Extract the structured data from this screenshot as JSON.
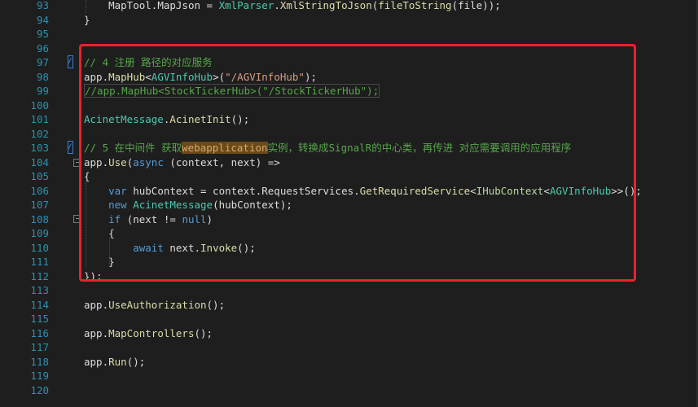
{
  "lines": [
    {
      "num": "93",
      "tokens": [
        {
          "t": "    MapTool.",
          "c": "t-d"
        },
        {
          "t": "MapJson",
          "c": "t-d"
        },
        {
          "t": " = ",
          "c": "t-d"
        },
        {
          "t": "XmlParser",
          "c": "t-y"
        },
        {
          "t": ".",
          "c": "t-d"
        },
        {
          "t": "XmlStringToJson",
          "c": "t-m"
        },
        {
          "t": "(",
          "c": "t-d"
        },
        {
          "t": "fileToString",
          "c": "t-m"
        },
        {
          "t": "(file));",
          "c": "t-d"
        }
      ]
    },
    {
      "num": "94",
      "tokens": [
        {
          "t": "}",
          "c": "t-d"
        }
      ]
    },
    {
      "num": "95",
      "tokens": []
    },
    {
      "num": "96",
      "tokens": []
    },
    {
      "num": "97",
      "tokens": [
        {
          "t": "// 4 注册 路径的对应服务",
          "c": "t-c"
        }
      ]
    },
    {
      "num": "98",
      "tokens": [
        {
          "t": "app.",
          "c": "t-d"
        },
        {
          "t": "MapHub",
          "c": "t-m"
        },
        {
          "t": "<",
          "c": "t-d"
        },
        {
          "t": "AGVInfoHub",
          "c": "t-y"
        },
        {
          "t": ">(",
          "c": "t-d"
        },
        {
          "t": "\"/AGVInfoHub\"",
          "c": "t-s"
        },
        {
          "t": ");",
          "c": "t-d"
        }
      ]
    },
    {
      "num": "99",
      "tokens": [
        {
          "t": "//app.MapHub<StockTickerHub>(\"/StockTickerHub\");",
          "c": "t-sel"
        }
      ]
    },
    {
      "num": "100",
      "tokens": []
    },
    {
      "num": "101",
      "tokens": [
        {
          "t": "AcinetMessage",
          "c": "t-y"
        },
        {
          "t": ".",
          "c": "t-d"
        },
        {
          "t": "AcinetInit",
          "c": "t-m"
        },
        {
          "t": "();",
          "c": "t-d"
        }
      ]
    },
    {
      "num": "102",
      "tokens": []
    },
    {
      "num": "103",
      "tokens": [
        {
          "t": "// 5 在中间件 获取",
          "c": "t-c"
        },
        {
          "t": "webapplication",
          "c": "t-hl"
        },
        {
          "t": "实例，转换成SignalR的中心类，再传进 对应需要调用的应用程序",
          "c": "t-c"
        }
      ]
    },
    {
      "num": "104",
      "tokens": [
        {
          "t": "app.",
          "c": "t-d"
        },
        {
          "t": "Use",
          "c": "t-m"
        },
        {
          "t": "(",
          "c": "t-d"
        },
        {
          "t": "async",
          "c": "t-k"
        },
        {
          "t": " (context, next) =>",
          "c": "t-d"
        }
      ]
    },
    {
      "num": "105",
      "tokens": [
        {
          "t": "{",
          "c": "t-d"
        }
      ]
    },
    {
      "num": "106",
      "tokens": [
        {
          "t": "    ",
          "c": "t-d"
        },
        {
          "t": "var",
          "c": "t-k"
        },
        {
          "t": " hubContext = context.RequestServices.",
          "c": "t-d"
        },
        {
          "t": "GetRequiredService",
          "c": "t-m"
        },
        {
          "t": "<",
          "c": "t-d"
        },
        {
          "t": "IHubContext",
          "c": "t-i"
        },
        {
          "t": "<",
          "c": "t-d"
        },
        {
          "t": "AGVInfoHub",
          "c": "t-y"
        },
        {
          "t": ">>();",
          "c": "t-d"
        }
      ]
    },
    {
      "num": "107",
      "tokens": [
        {
          "t": "    ",
          "c": "t-d"
        },
        {
          "t": "new",
          "c": "t-k"
        },
        {
          "t": " ",
          "c": "t-d"
        },
        {
          "t": "AcinetMessage",
          "c": "t-y"
        },
        {
          "t": "(hubContext);",
          "c": "t-d"
        }
      ]
    },
    {
      "num": "108",
      "tokens": [
        {
          "t": "    ",
          "c": "t-d"
        },
        {
          "t": "if",
          "c": "t-k"
        },
        {
          "t": " (next != ",
          "c": "t-d"
        },
        {
          "t": "null",
          "c": "t-k"
        },
        {
          "t": ")",
          "c": "t-d"
        }
      ]
    },
    {
      "num": "109",
      "tokens": [
        {
          "t": "    {",
          "c": "t-d"
        }
      ]
    },
    {
      "num": "110",
      "tokens": [
        {
          "t": "        ",
          "c": "t-d"
        },
        {
          "t": "await",
          "c": "t-k"
        },
        {
          "t": " next.",
          "c": "t-d"
        },
        {
          "t": "Invoke",
          "c": "t-m"
        },
        {
          "t": "();",
          "c": "t-d"
        }
      ]
    },
    {
      "num": "111",
      "tokens": [
        {
          "t": "    }",
          "c": "t-d"
        }
      ]
    },
    {
      "num": "112",
      "tokens": [
        {
          "t": "});",
          "c": "t-d"
        }
      ]
    },
    {
      "num": "113",
      "tokens": []
    },
    {
      "num": "114",
      "tokens": [
        {
          "t": "app.",
          "c": "t-d"
        },
        {
          "t": "UseAuthorization",
          "c": "t-m"
        },
        {
          "t": "();",
          "c": "t-d"
        }
      ]
    },
    {
      "num": "115",
      "tokens": []
    },
    {
      "num": "116",
      "tokens": [
        {
          "t": "app.",
          "c": "t-d"
        },
        {
          "t": "MapControllers",
          "c": "t-m"
        },
        {
          "t": "();",
          "c": "t-d"
        }
      ]
    },
    {
      "num": "117",
      "tokens": []
    },
    {
      "num": "118",
      "tokens": [
        {
          "t": "app.",
          "c": "t-d"
        },
        {
          "t": "Run",
          "c": "t-m"
        },
        {
          "t": "();",
          "c": "t-d"
        }
      ]
    },
    {
      "num": "119",
      "tokens": []
    },
    {
      "num": "120",
      "tokens": []
    }
  ],
  "colors": {
    "background": "#1e1e1e",
    "line_number": "#2b91af",
    "keyword": "#569cd6",
    "comment": "#57a64a",
    "string": "#d69d85",
    "type": "#4ec9b0",
    "method": "#dcdcaa",
    "annotation_box": "#e8232b"
  },
  "icons": {
    "change_marker": "pencil-edit-icon",
    "fold_toggle": "collapse-minus-icon"
  }
}
